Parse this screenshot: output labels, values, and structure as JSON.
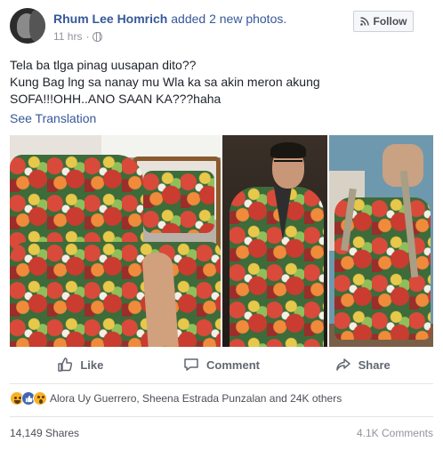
{
  "post": {
    "author": "Rhum Lee Homrich",
    "action": "added 2 new photos.",
    "time": "11 hrs",
    "separator": "·",
    "follow_label": "Follow",
    "text": "Tela ba tlga pinag uusapan dito??\nKung Bag lng sa nanay mu Wla ka sa akin meron akung\nSOFA!!!OHH..ANO SAAN KA???haha",
    "see_translation": "See Translation"
  },
  "actions": {
    "like": "Like",
    "comment": "Comment",
    "share": "Share"
  },
  "reactions": {
    "types": [
      "haha",
      "like",
      "wow"
    ],
    "names": "Alora Uy Guerrero, Sheena Estrada Punzalan and 24K others"
  },
  "stats": {
    "shares": "14,149 Shares",
    "comments": "4.1K Comments"
  },
  "colors": {
    "link": "#365899",
    "like_blue": "#4267b2",
    "emoji_yellow": "#f7b125"
  },
  "icons": [
    "globe-icon",
    "rss-icon",
    "thumbs-up-icon",
    "comment-icon",
    "share-arrow-icon"
  ]
}
